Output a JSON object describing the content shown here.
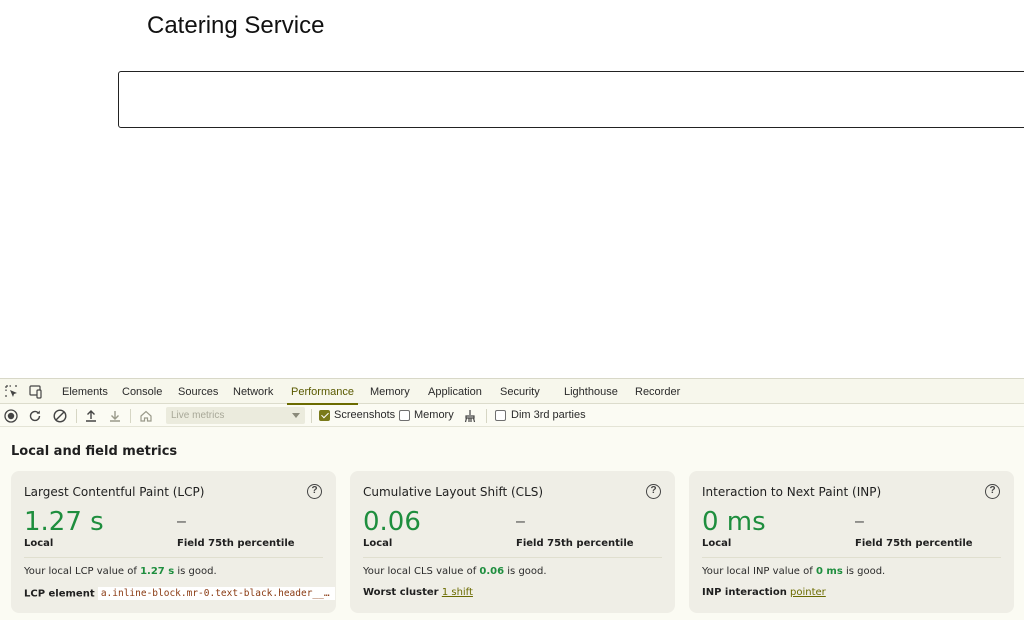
{
  "page": {
    "title": "Catering Service"
  },
  "devtools": {
    "tabs": [
      "Elements",
      "Console",
      "Sources",
      "Network",
      "Performance",
      "Memory",
      "Application",
      "Security",
      "Lighthouse",
      "Recorder"
    ],
    "active_tab": "Performance",
    "toolbar": {
      "metrics_select": "Live metrics",
      "screenshots_label": "Screenshots",
      "screenshots_checked": true,
      "memory_label": "Memory",
      "memory_checked": false,
      "dim_label": "Dim 3rd parties",
      "dim_checked": false
    },
    "section_title": "Local and field metrics",
    "cards": [
      {
        "title": "Largest Contentful Paint (LCP)",
        "value": "1.27 s",
        "local_label": "Local",
        "field_value": "–",
        "field_label": "Field 75th percentile",
        "desc_prefix": "Your local LCP value of ",
        "desc_value": "1.27 s",
        "desc_suffix": " is good.",
        "foot_label": "LCP element",
        "foot_value": "a.inline-block.mr-0.text-black.header__b…"
      },
      {
        "title": "Cumulative Layout Shift (CLS)",
        "value": "0.06",
        "local_label": "Local",
        "field_value": "–",
        "field_label": "Field 75th percentile",
        "desc_prefix": "Your local CLS value of ",
        "desc_value": "0.06",
        "desc_suffix": " is good.",
        "foot_label": "Worst cluster",
        "foot_value": "1 shift"
      },
      {
        "title": "Interaction to Next Paint (INP)",
        "value": "0 ms",
        "local_label": "Local",
        "field_value": "–",
        "field_label": "Field 75th percentile",
        "desc_prefix": "Your local INP value of ",
        "desc_value": "0 ms",
        "desc_suffix": " is good.",
        "foot_label": "INP interaction",
        "foot_value": "pointer"
      }
    ],
    "colors": {
      "good": "#1e8e3e",
      "accent": "#6b6b00"
    },
    "icons": [
      "inspect-element-icon",
      "device-toolbar-icon",
      "record-icon",
      "reload-icon",
      "clear-icon",
      "upload-icon",
      "download-icon",
      "home-icon",
      "broom-icon",
      "help-icon"
    ]
  }
}
